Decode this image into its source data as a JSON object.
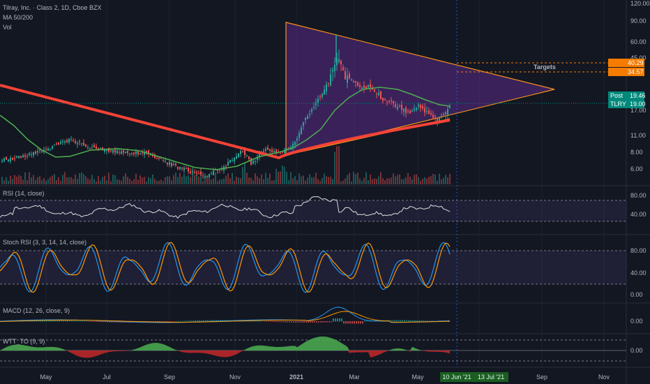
{
  "header": {
    "symbol": "Tilray, Inc. · Class 2, 1D, Cboe BZX",
    "ma": "MA 50/200",
    "vol": "Vol"
  },
  "price_axis": [
    "120.00",
    "90.00",
    "60.00",
    "45.00",
    "17.00",
    "11.00",
    "8.00",
    "6.00"
  ],
  "price_tags": {
    "t1": "40.29",
    "t2": "34.57",
    "post_label": "Post",
    "post": "19.46",
    "sym_label": "TLRY",
    "last": "19.00",
    "targets": "Targets"
  },
  "rsi": {
    "label": "RSI (14, close)",
    "ticks": [
      "80.00",
      "40.00"
    ]
  },
  "stoch": {
    "label": "Stoch RSI (3, 3, 14, 14, close)",
    "ticks": [
      "80.00",
      "40.00",
      "0.00"
    ]
  },
  "macd": {
    "label": "MACD (12, 26, close, 9)",
    "tick": "0.00"
  },
  "wtt": {
    "label": "WTT_TO (9, 9)",
    "tick": "0.00"
  },
  "time_axis": [
    "May",
    "Jul",
    "Sep",
    "Nov",
    "2021",
    "Mar",
    "May",
    "Sep",
    "Nov"
  ],
  "date_tags": [
    "10 Jun '21",
    "13 Jul '21"
  ],
  "colors": {
    "bg": "#131722",
    "up": "#26a69a",
    "down": "#ef5350",
    "ma50": "#4caf50",
    "ma200": "#f44336",
    "triangle": "#f7931a",
    "triangle_fill": "#5b2a86",
    "teal_tag": "#00897b",
    "orange_tag": "#f57c00"
  }
}
